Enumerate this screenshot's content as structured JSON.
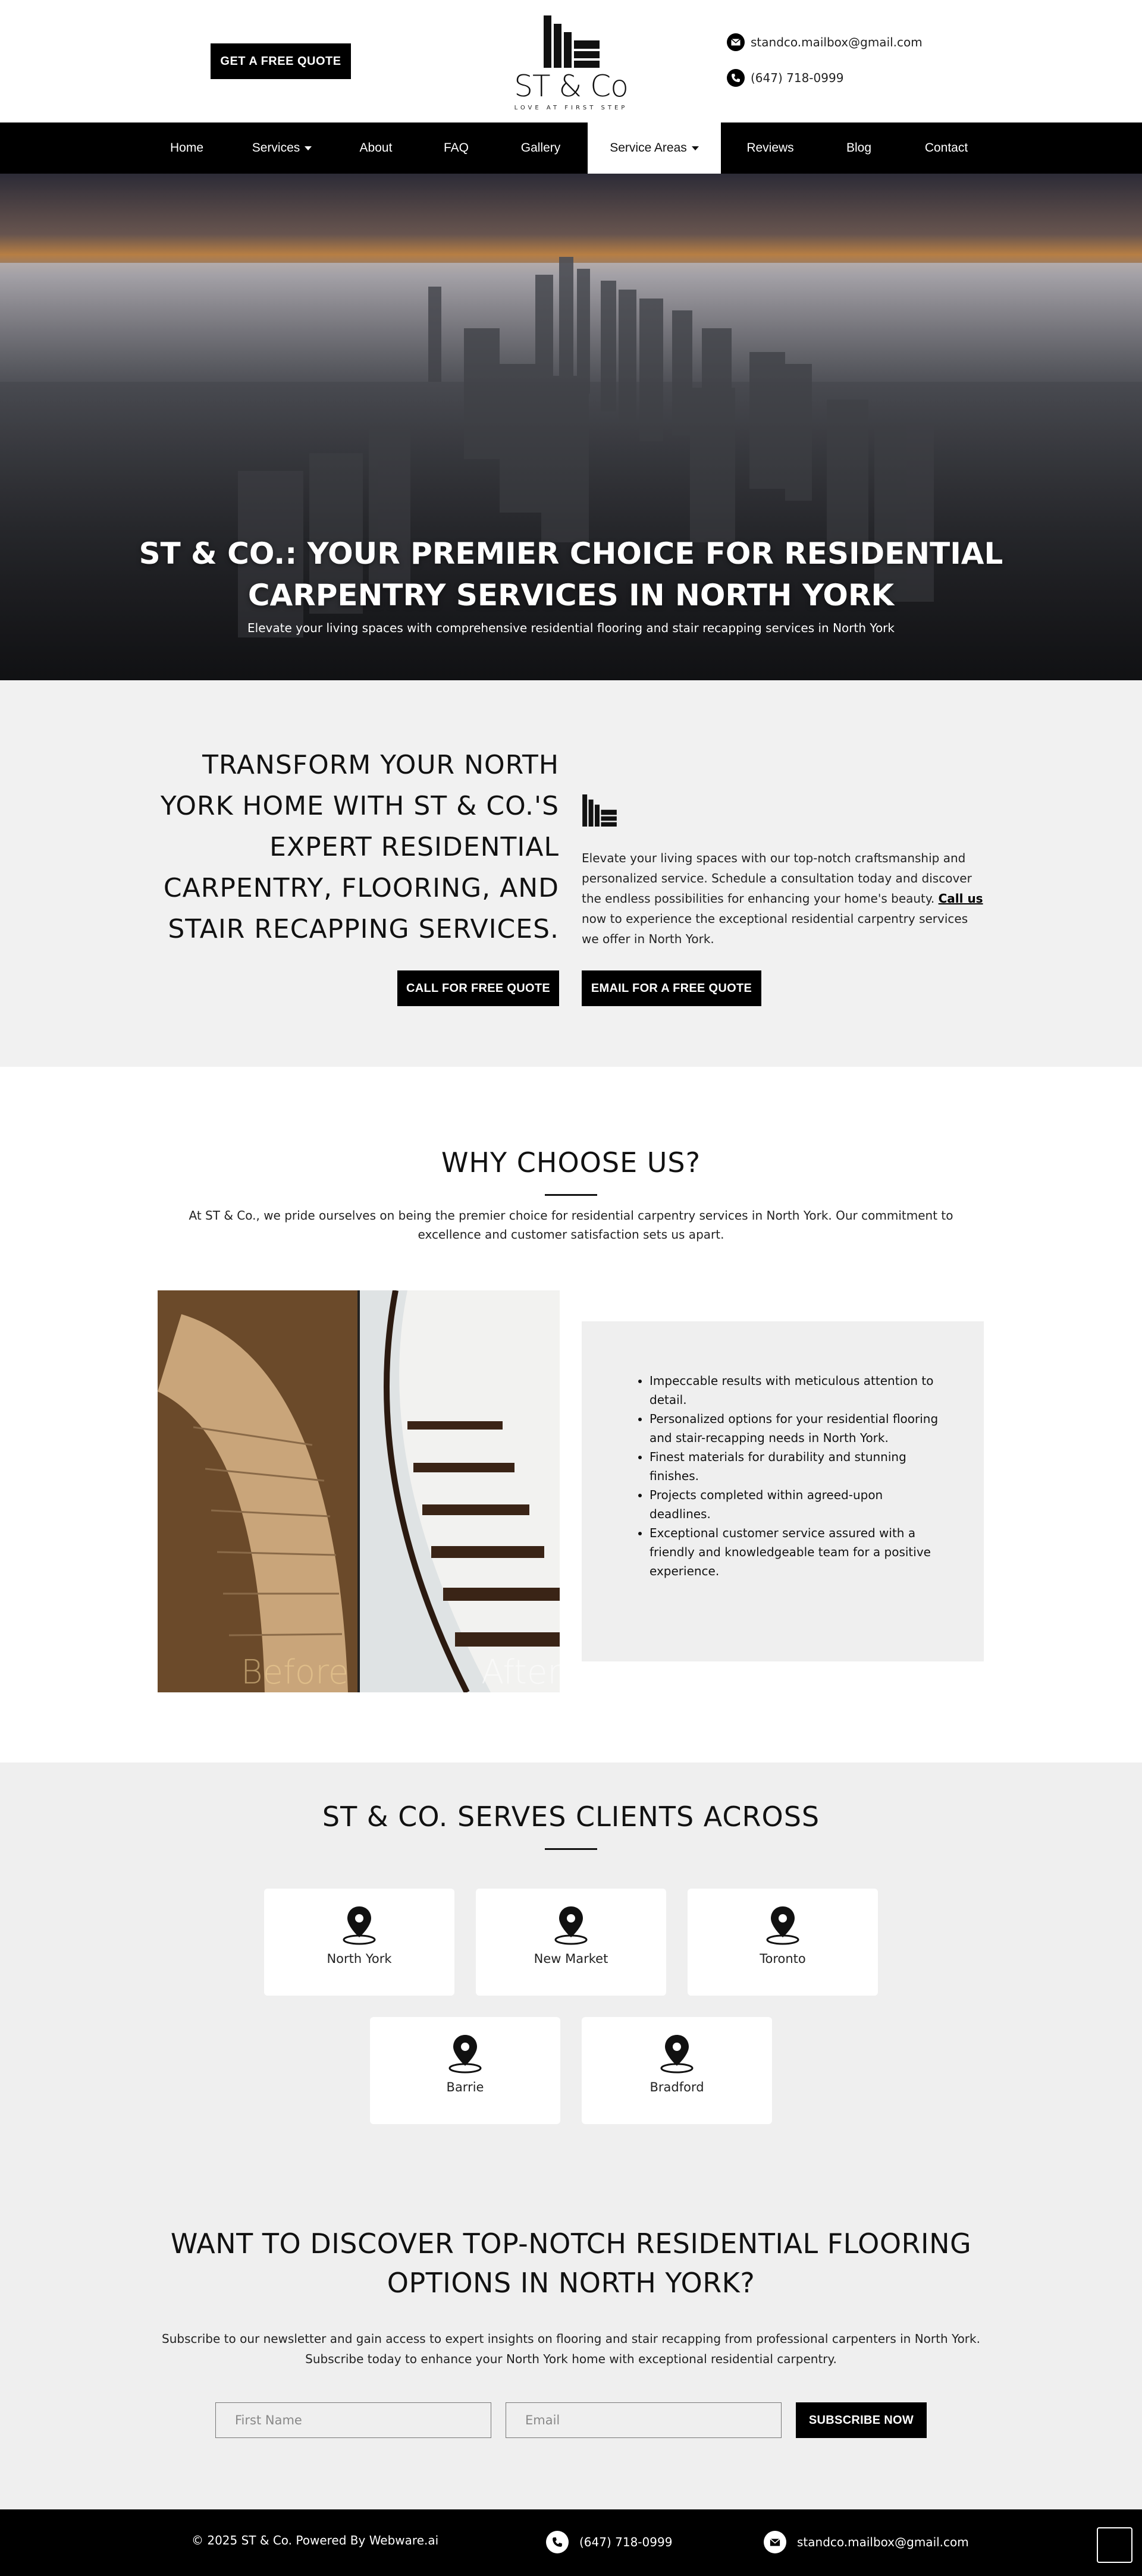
{
  "header": {
    "quote_button": "GET A FREE QUOTE",
    "logo_name": "ST & Co",
    "logo_tagline": "LOVE AT FIRST STEP",
    "email": "standco.mailbox@gmail.com",
    "phone": "(647) 718-0999"
  },
  "nav": {
    "items": [
      {
        "label": "Home"
      },
      {
        "label": "Services",
        "dropdown": true
      },
      {
        "label": "About"
      },
      {
        "label": "FAQ"
      },
      {
        "label": "Gallery"
      },
      {
        "label": "Service Areas",
        "dropdown": true,
        "active": true
      },
      {
        "label": "Reviews"
      },
      {
        "label": "Blog"
      },
      {
        "label": "Contact"
      }
    ]
  },
  "hero": {
    "title_line1": "ST & CO.: YOUR PREMIER CHOICE FOR RESIDENTIAL",
    "title_line2": "CARPENTRY SERVICES IN NORTH YORK",
    "subtitle": "Elevate your living spaces with comprehensive residential flooring and stair recapping services in North York"
  },
  "transform": {
    "heading": "TRANSFORM YOUR NORTH YORK HOME WITH ST & CO.'S EXPERT RESIDENTIAL CARPENTRY, FLOORING, AND STAIR RECAPPING SERVICES.",
    "desc_before": "Elevate your living spaces with our top-notch craftsmanship and personalized service. Schedule a consultation today and discover the endless possibilities for enhancing your home's beauty. ",
    "desc_link": "Call us",
    "desc_after": " now to experience the exceptional residential carpentry services we offer in North York.",
    "call_button": "CALL FOR FREE QUOTE",
    "email_button": "EMAIL FOR A FREE QUOTE"
  },
  "why": {
    "heading": "WHY CHOOSE US?",
    "intro": "At ST & Co., we pride ourselves on being the premier choice for residential carpentry services in North York. Our commitment to excellence and customer satisfaction sets us apart.",
    "before_label": "Before",
    "after_label": "After",
    "bullets": [
      "Impeccable results with meticulous attention to detail.",
      "Personalized options for your residential flooring and stair-recapping needs in North York.",
      "Finest materials for durability and stunning finishes.",
      "Projects completed within agreed-upon deadlines.",
      "Exceptional customer service assured with a friendly and knowledgeable team for a positive experience."
    ]
  },
  "serves": {
    "heading": "ST & CO. SERVES CLIENTS ACROSS",
    "areas": [
      "North York",
      "New Market",
      "Toronto",
      "Barrie",
      "Bradford"
    ],
    "cta_heading_line1": "WANT TO DISCOVER TOP-NOTCH RESIDENTIAL FLOORING",
    "cta_heading_line2": "OPTIONS IN NORTH YORK?",
    "cta_sub_line1": "Subscribe to our newsletter and gain access to expert insights on flooring and stair recapping from professional carpenters in North York.",
    "cta_sub_line2": "Subscribe today to enhance your North York home with exceptional residential carpentry.",
    "first_name_placeholder": "First Name",
    "email_placeholder": "Email",
    "subscribe_button": "SUBSCRIBE NOW"
  },
  "footer": {
    "copyright": "© 2025 ST & Co. Powered By Webware.ai",
    "phone": "(647) 718-0999",
    "email": "standco.mailbox@gmail.com"
  },
  "colors": {
    "accent": "#000000",
    "section_bg": "#efefef"
  }
}
